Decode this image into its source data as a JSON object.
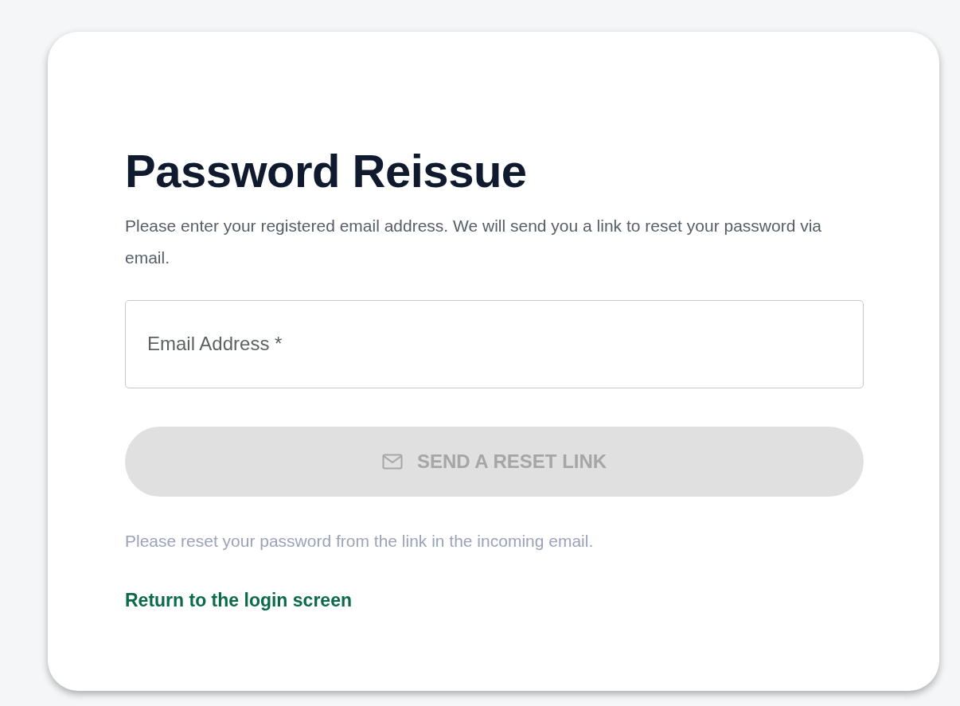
{
  "title": "Password Reissue",
  "description": "Please enter your registered email address. We will send you a link to reset your password via email.",
  "email_field": {
    "placeholder": "Email Address *"
  },
  "send_button": {
    "label": "SEND A RESET LINK",
    "disabled": true
  },
  "note": "Please reset your password from the link in the incoming email.",
  "login_link": "Return to the login screen"
}
